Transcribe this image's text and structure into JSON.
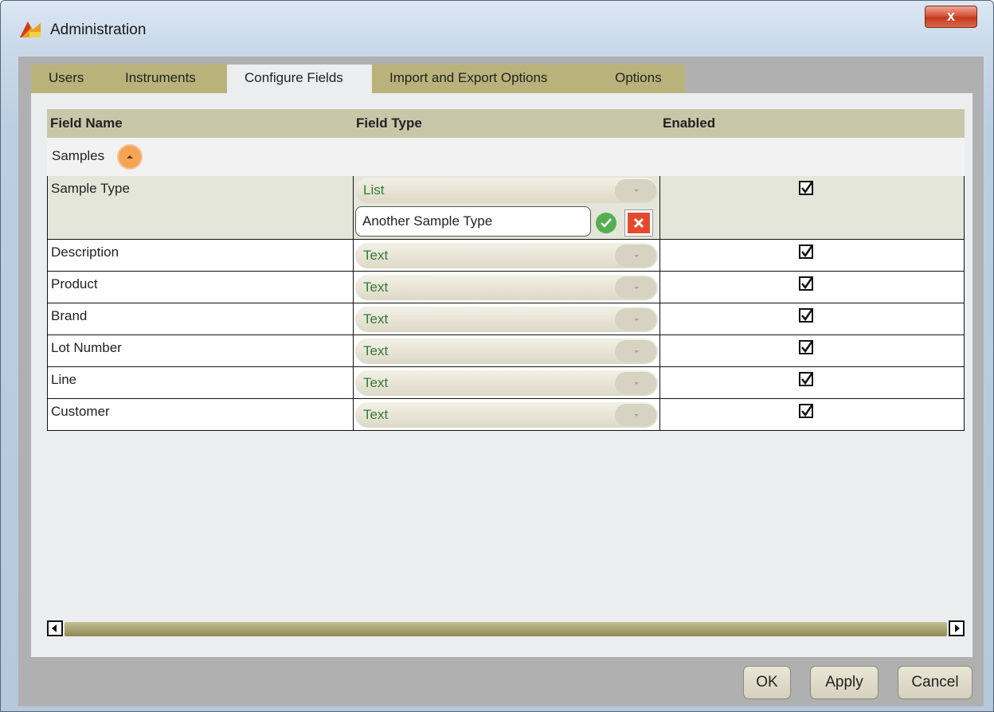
{
  "window": {
    "title": "Administration",
    "close_label": "x"
  },
  "tabs": [
    {
      "label": "Users",
      "active": false
    },
    {
      "label": "Instruments",
      "active": false
    },
    {
      "label": "Configure Fields",
      "active": true
    },
    {
      "label": "Import and Export Options",
      "active": false
    },
    {
      "label": "Options",
      "active": false
    }
  ],
  "grid": {
    "columns": [
      "Field Name",
      "Field Type",
      "Enabled"
    ],
    "group": {
      "label": "Samples",
      "expanded": true
    },
    "editing_row": {
      "field_name": "Sample Type",
      "field_type": "List",
      "enabled": true,
      "new_item_value": "Another Sample Type"
    },
    "rows": [
      {
        "field_name": "Description",
        "field_type": "Text",
        "enabled": true
      },
      {
        "field_name": "Product",
        "field_type": "Text",
        "enabled": true
      },
      {
        "field_name": "Brand",
        "field_type": "Text",
        "enabled": true
      },
      {
        "field_name": "Lot Number",
        "field_type": "Text",
        "enabled": true
      },
      {
        "field_name": "Line",
        "field_type": "Text",
        "enabled": true
      },
      {
        "field_name": "Customer",
        "field_type": "Text",
        "enabled": true
      }
    ]
  },
  "buttons": {
    "ok": "OK",
    "apply": "Apply",
    "cancel": "Cancel"
  },
  "colors": {
    "tab_inactive": "#b9b37b",
    "header_bg": "#c9c7a9",
    "field_type_text": "#2e7d32",
    "accent_orange": "#f7a355"
  }
}
